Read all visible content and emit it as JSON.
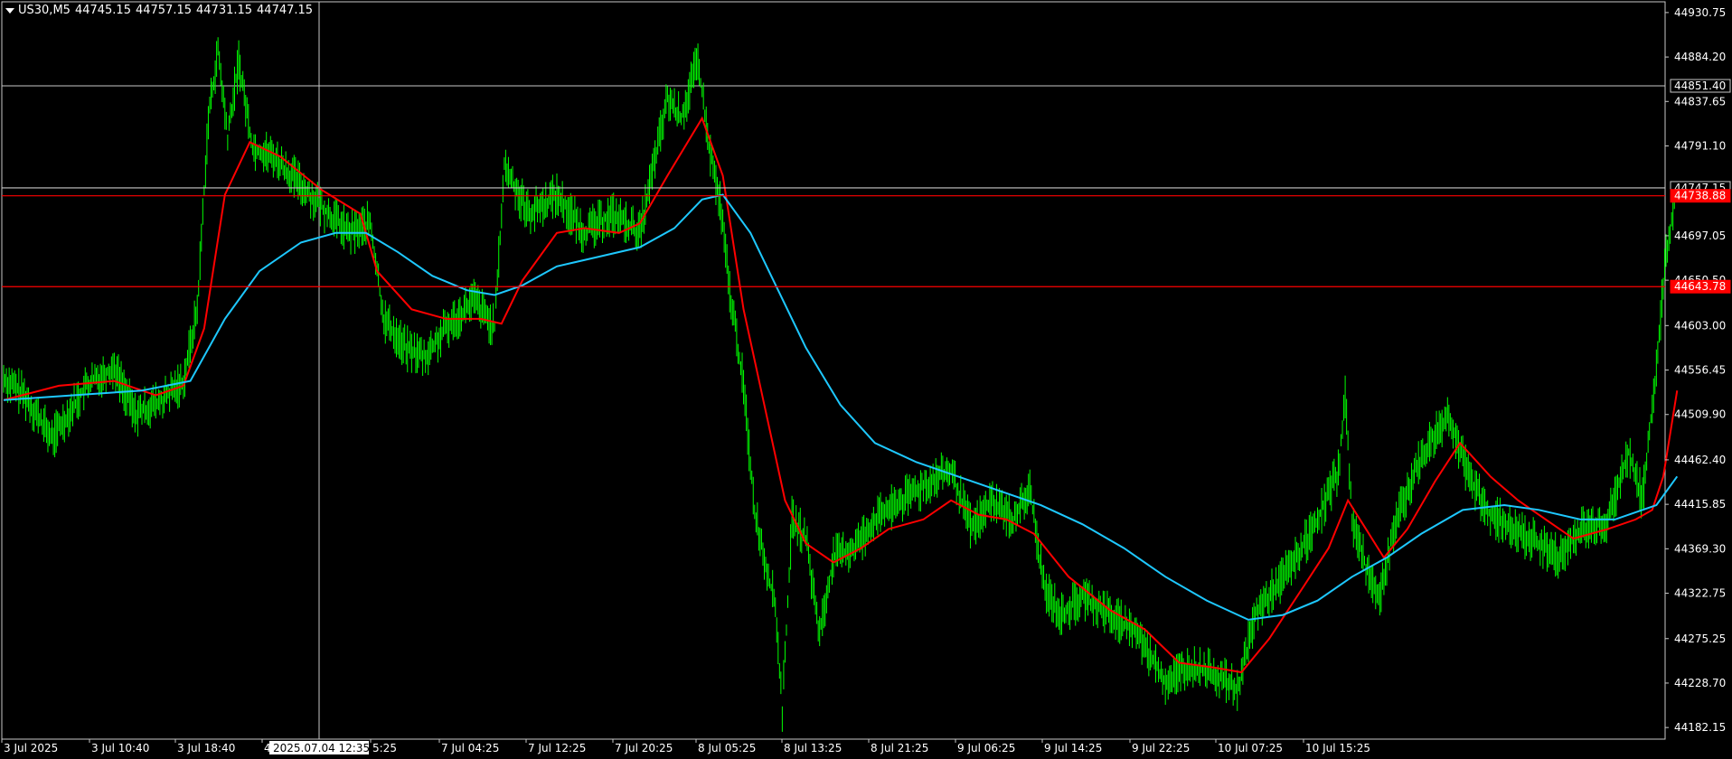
{
  "header": {
    "symbol": "US30,M5",
    "open": "44745.15",
    "high": "44757.15",
    "low": "44731.15",
    "close": "44747.15"
  },
  "crosshair": {
    "time_label": "2025.07.04 12:35",
    "price_label": "44851.40"
  },
  "colors": {
    "background": "#000000",
    "frame": "#c8c8c8",
    "text": "#ffffff",
    "bar_up": "#00ff00",
    "bar_down": "#00ff00",
    "ma_fast": "#ff0000",
    "ma_slow": "#1ec8ff",
    "level": "#ff0000",
    "crosshair": "#c8c8c8"
  },
  "chart_data": {
    "type": "line",
    "title": "",
    "price_axis_ticks": [
      "44930.75",
      "44884.20",
      "44837.65",
      "44791.10",
      "44697.05",
      "44650.50",
      "44603.00",
      "44556.45",
      "44509.90",
      "44462.40",
      "44415.85",
      "44369.30",
      "44322.75",
      "44275.25",
      "44228.70",
      "44182.15"
    ],
    "time_axis_ticks": [
      "3 Jul 2025",
      "3 Jul 10:40",
      "3 Jul 18:40",
      "4",
      "5:25",
      "7 Jul 04:25",
      "7 Jul 12:25",
      "7 Jul 20:25",
      "8 Jul 05:25",
      "8 Jul 13:25",
      "8 Jul 21:25",
      "9 Jul 06:25",
      "9 Jul 14:25",
      "9 Jul 22:25",
      "10 Jul 07:25",
      "10 Jul 15:25"
    ],
    "ylim": [
      44170,
      44942
    ],
    "price_lines": [
      {
        "name": "current-price",
        "value": 44747.15,
        "label": "44747.15",
        "style": "white"
      },
      {
        "name": "level-upper",
        "value": 44738.88,
        "label": "44738.88",
        "style": "red"
      },
      {
        "name": "level-lower",
        "value": 44643.78,
        "label": "44643.78",
        "style": "red"
      }
    ],
    "series": [
      {
        "kind": "price",
        "points": [
          [
            0,
            44548
          ],
          [
            15,
            44530
          ],
          [
            35,
            44485
          ],
          [
            60,
            44540
          ],
          [
            80,
            44560
          ],
          [
            95,
            44510
          ],
          [
            115,
            44525
          ],
          [
            130,
            44545
          ],
          [
            140,
            44620
          ],
          [
            148,
            44820
          ],
          [
            155,
            44890
          ],
          [
            162,
            44800
          ],
          [
            170,
            44880
          ],
          [
            180,
            44790
          ],
          [
            195,
            44780
          ],
          [
            215,
            44750
          ],
          [
            235,
            44720
          ],
          [
            250,
            44700
          ],
          [
            265,
            44710
          ],
          [
            275,
            44610
          ],
          [
            290,
            44580
          ],
          [
            305,
            44570
          ],
          [
            320,
            44600
          ],
          [
            340,
            44630
          ],
          [
            355,
            44600
          ],
          [
            362,
            44770
          ],
          [
            380,
            44720
          ],
          [
            400,
            44740
          ],
          [
            420,
            44700
          ],
          [
            440,
            44720
          ],
          [
            460,
            44700
          ],
          [
            470,
            44770
          ],
          [
            480,
            44840
          ],
          [
            490,
            44820
          ],
          [
            502,
            44880
          ],
          [
            510,
            44790
          ],
          [
            518,
            44730
          ],
          [
            525,
            44640
          ],
          [
            535,
            44540
          ],
          [
            543,
            44410
          ],
          [
            550,
            44360
          ],
          [
            558,
            44310
          ],
          [
            563,
            44200
          ],
          [
            570,
            44400
          ],
          [
            580,
            44380
          ],
          [
            590,
            44280
          ],
          [
            600,
            44360
          ],
          [
            615,
            44370
          ],
          [
            630,
            44400
          ],
          [
            650,
            44420
          ],
          [
            670,
            44440
          ],
          [
            685,
            44450
          ],
          [
            700,
            44390
          ],
          [
            715,
            44420
          ],
          [
            730,
            44400
          ],
          [
            742,
            44430
          ],
          [
            752,
            44330
          ],
          [
            765,
            44300
          ],
          [
            780,
            44320
          ],
          [
            800,
            44300
          ],
          [
            820,
            44280
          ],
          [
            840,
            44230
          ],
          [
            855,
            44245
          ],
          [
            875,
            44240
          ],
          [
            892,
            44220
          ],
          [
            905,
            44300
          ],
          [
            920,
            44330
          ],
          [
            935,
            44360
          ],
          [
            950,
            44400
          ],
          [
            965,
            44450
          ],
          [
            970,
            44530
          ],
          [
            975,
            44400
          ],
          [
            985,
            44350
          ],
          [
            995,
            44320
          ],
          [
            1005,
            44390
          ],
          [
            1020,
            44450
          ],
          [
            1035,
            44490
          ],
          [
            1045,
            44510
          ],
          [
            1058,
            44450
          ],
          [
            1072,
            44410
          ],
          [
            1090,
            44390
          ],
          [
            1110,
            44375
          ],
          [
            1125,
            44360
          ],
          [
            1140,
            44390
          ],
          [
            1160,
            44400
          ],
          [
            1175,
            44470
          ],
          [
            1185,
            44420
          ],
          [
            1195,
            44560
          ],
          [
            1202,
            44680
          ],
          [
            1210,
            44745
          ]
        ]
      },
      {
        "kind": "ma_fast",
        "points": [
          [
            0,
            44525
          ],
          [
            40,
            44540
          ],
          [
            80,
            44545
          ],
          [
            110,
            44530
          ],
          [
            130,
            44540
          ],
          [
            145,
            44600
          ],
          [
            160,
            44740
          ],
          [
            178,
            44795
          ],
          [
            200,
            44780
          ],
          [
            230,
            44745
          ],
          [
            258,
            44720
          ],
          [
            270,
            44660
          ],
          [
            295,
            44620
          ],
          [
            320,
            44610
          ],
          [
            345,
            44610
          ],
          [
            360,
            44605
          ],
          [
            375,
            44650
          ],
          [
            400,
            44700
          ],
          [
            420,
            44705
          ],
          [
            445,
            44700
          ],
          [
            460,
            44710
          ],
          [
            480,
            44760
          ],
          [
            505,
            44820
          ],
          [
            520,
            44760
          ],
          [
            535,
            44620
          ],
          [
            550,
            44520
          ],
          [
            565,
            44420
          ],
          [
            580,
            44375
          ],
          [
            600,
            44355
          ],
          [
            620,
            44370
          ],
          [
            640,
            44390
          ],
          [
            665,
            44400
          ],
          [
            685,
            44420
          ],
          [
            705,
            44405
          ],
          [
            725,
            44400
          ],
          [
            745,
            44385
          ],
          [
            770,
            44340
          ],
          [
            800,
            44305
          ],
          [
            825,
            44285
          ],
          [
            850,
            44250
          ],
          [
            875,
            44245
          ],
          [
            895,
            44240
          ],
          [
            915,
            44275
          ],
          [
            940,
            44330
          ],
          [
            958,
            44370
          ],
          [
            972,
            44420
          ],
          [
            985,
            44390
          ],
          [
            998,
            44360
          ],
          [
            1015,
            44390
          ],
          [
            1035,
            44440
          ],
          [
            1053,
            44480
          ],
          [
            1075,
            44445
          ],
          [
            1095,
            44420
          ],
          [
            1115,
            44400
          ],
          [
            1135,
            44380
          ],
          [
            1160,
            44390
          ],
          [
            1180,
            44400
          ],
          [
            1192,
            44410
          ],
          [
            1200,
            44445
          ],
          [
            1210,
            44535
          ]
        ]
      },
      {
        "kind": "ma_slow",
        "points": [
          [
            0,
            44525
          ],
          [
            50,
            44530
          ],
          [
            100,
            44535
          ],
          [
            135,
            44545
          ],
          [
            160,
            44610
          ],
          [
            185,
            44660
          ],
          [
            215,
            44690
          ],
          [
            240,
            44700
          ],
          [
            262,
            44700
          ],
          [
            285,
            44680
          ],
          [
            310,
            44655
          ],
          [
            335,
            44640
          ],
          [
            355,
            44635
          ],
          [
            375,
            44645
          ],
          [
            400,
            44665
          ],
          [
            430,
            44675
          ],
          [
            460,
            44685
          ],
          [
            485,
            44705
          ],
          [
            505,
            44735
          ],
          [
            520,
            44740
          ],
          [
            540,
            44700
          ],
          [
            560,
            44640
          ],
          [
            580,
            44580
          ],
          [
            605,
            44520
          ],
          [
            630,
            44480
          ],
          [
            660,
            44460
          ],
          [
            690,
            44445
          ],
          [
            720,
            44430
          ],
          [
            750,
            44415
          ],
          [
            780,
            44395
          ],
          [
            810,
            44370
          ],
          [
            840,
            44340
          ],
          [
            870,
            44315
          ],
          [
            900,
            44295
          ],
          [
            925,
            44300
          ],
          [
            950,
            44315
          ],
          [
            975,
            44340
          ],
          [
            1000,
            44360
          ],
          [
            1025,
            44385
          ],
          [
            1055,
            44410
          ],
          [
            1085,
            44415
          ],
          [
            1110,
            44410
          ],
          [
            1140,
            44400
          ],
          [
            1165,
            44400
          ],
          [
            1185,
            44410
          ],
          [
            1195,
            44415
          ],
          [
            1210,
            44445
          ]
        ]
      }
    ]
  }
}
